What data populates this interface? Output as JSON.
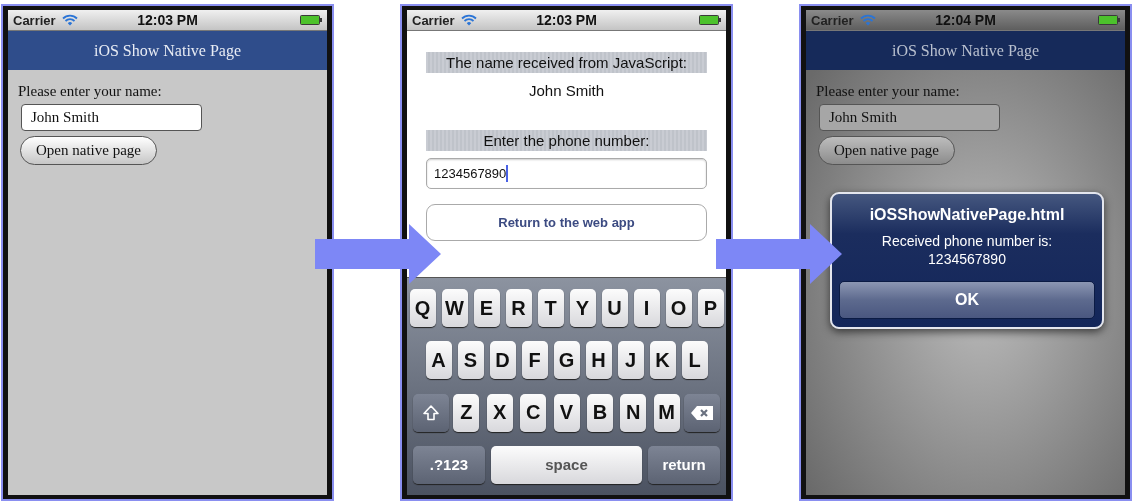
{
  "screens": [
    {
      "kind": "web",
      "status_bar": {
        "carrier": "Carrier",
        "time": "12:03 PM"
      },
      "nav_title": "iOS Show Native Page",
      "prompt": "Please enter your name:",
      "name_field": {
        "value": "John Smith"
      },
      "button": "Open native page",
      "dimmed": false
    },
    {
      "kind": "native",
      "status_bar": {
        "carrier": "Carrier",
        "time": "12:03 PM"
      },
      "received_label": "The name received from JavaScript:",
      "received_name": "John Smith",
      "phone_label": "Enter the phone number:",
      "phone_field": {
        "value": "1234567890",
        "focused": true
      },
      "button": "Return to the web app",
      "keyboard": {
        "rows": [
          [
            {
              "kind": "letter",
              "label": "Q"
            },
            {
              "kind": "letter",
              "label": "W"
            },
            {
              "kind": "letter",
              "label": "E"
            },
            {
              "kind": "letter",
              "label": "R"
            },
            {
              "kind": "letter",
              "label": "T"
            },
            {
              "kind": "letter",
              "label": "Y"
            },
            {
              "kind": "letter",
              "label": "U"
            },
            {
              "kind": "letter",
              "label": "I"
            },
            {
              "kind": "letter",
              "label": "O"
            },
            {
              "kind": "letter",
              "label": "P"
            }
          ],
          [
            {
              "kind": "letter",
              "label": "A"
            },
            {
              "kind": "letter",
              "label": "S"
            },
            {
              "kind": "letter",
              "label": "D"
            },
            {
              "kind": "letter",
              "label": "F"
            },
            {
              "kind": "letter",
              "label": "G"
            },
            {
              "kind": "letter",
              "label": "H"
            },
            {
              "kind": "letter",
              "label": "J"
            },
            {
              "kind": "letter",
              "label": "K"
            },
            {
              "kind": "letter",
              "label": "L"
            }
          ],
          [
            {
              "kind": "shift"
            },
            {
              "kind": "letter",
              "label": "Z"
            },
            {
              "kind": "letter",
              "label": "X"
            },
            {
              "kind": "letter",
              "label": "C"
            },
            {
              "kind": "letter",
              "label": "V"
            },
            {
              "kind": "letter",
              "label": "B"
            },
            {
              "kind": "letter",
              "label": "N"
            },
            {
              "kind": "letter",
              "label": "M"
            },
            {
              "kind": "delete"
            }
          ]
        ],
        "bottom_row": {
          "mode_key": ".?123",
          "space_key": "space",
          "return_key": "return"
        }
      }
    },
    {
      "kind": "web",
      "status_bar": {
        "carrier": "Carrier",
        "time": "12:04 PM"
      },
      "nav_title": "iOS Show Native Page",
      "prompt": "Please enter your name:",
      "name_field": {
        "value": "John Smith"
      },
      "button": "Open native page",
      "dimmed": true,
      "alert": {
        "title": "iOSShowNativePage.html",
        "message": "Received phone number is:",
        "value": "1234567890",
        "button": "OK"
      }
    }
  ]
}
